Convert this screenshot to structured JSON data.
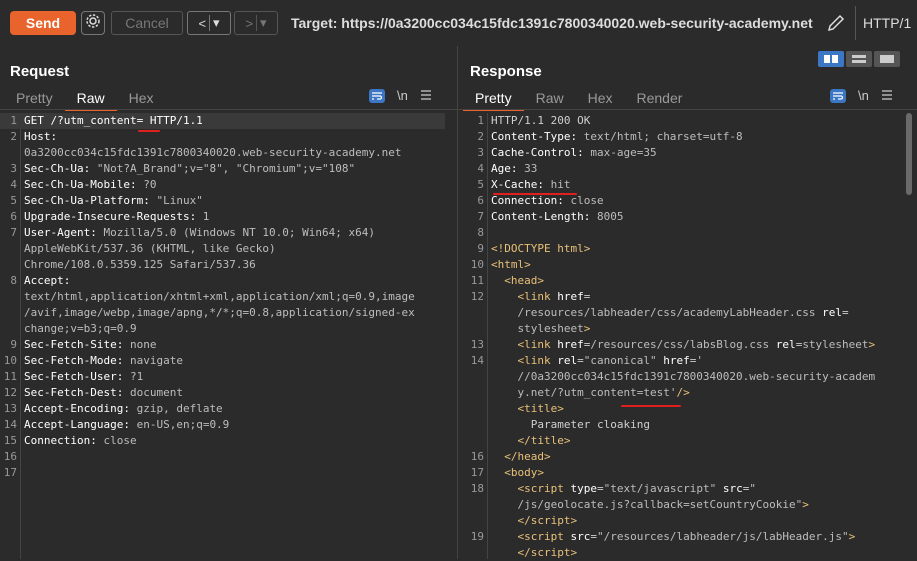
{
  "toolbar": {
    "send_label": "Send",
    "cancel_label": "Cancel",
    "back_label": "<",
    "fwd_label": ">",
    "dropdown_glyph": "▾",
    "target": "Target: https://0a3200cc034c15fdc1391c7800340020.web-security-academy.net",
    "protocol": "HTTP/1"
  },
  "request": {
    "title": "Request",
    "tabs": [
      "Pretty",
      "Raw",
      "Hex"
    ],
    "active_tab": "Raw",
    "newline_toggle": "\\n",
    "lines": [
      {
        "n": "1",
        "k": "GET /?utm_content= HTTP/1.1",
        "v": ""
      },
      {
        "n": "2",
        "k": "Host:",
        "v": ""
      },
      {
        "n": "",
        "k": "",
        "v": "0a3200cc034c15fdc1391c7800340020.web-security-academy.net"
      },
      {
        "n": "3",
        "k": "Sec-Ch-Ua:",
        "v": " \"Not?A_Brand\";v=\"8\", \"Chromium\";v=\"108\""
      },
      {
        "n": "4",
        "k": "Sec-Ch-Ua-Mobile:",
        "v": " ?0"
      },
      {
        "n": "5",
        "k": "Sec-Ch-Ua-Platform:",
        "v": " \"Linux\""
      },
      {
        "n": "6",
        "k": "Upgrade-Insecure-Requests:",
        "v": " 1"
      },
      {
        "n": "7",
        "k": "User-Agent:",
        "v": " Mozilla/5.0 (Windows NT 10.0; Win64; x64)"
      },
      {
        "n": "",
        "k": "",
        "v": "AppleWebKit/537.36 (KHTML, like Gecko)"
      },
      {
        "n": "",
        "k": "",
        "v": "Chrome/108.0.5359.125 Safari/537.36"
      },
      {
        "n": "8",
        "k": "Accept:",
        "v": ""
      },
      {
        "n": "",
        "k": "",
        "v": "text/html,application/xhtml+xml,application/xml;q=0.9,image"
      },
      {
        "n": "",
        "k": "",
        "v": "/avif,image/webp,image/apng,*/*;q=0.8,application/signed-ex"
      },
      {
        "n": "",
        "k": "",
        "v": "change;v=b3;q=0.9"
      },
      {
        "n": "9",
        "k": "Sec-Fetch-Site:",
        "v": " none"
      },
      {
        "n": "10",
        "k": "Sec-Fetch-Mode:",
        "v": " navigate"
      },
      {
        "n": "11",
        "k": "Sec-Fetch-User:",
        "v": " ?1"
      },
      {
        "n": "12",
        "k": "Sec-Fetch-Dest:",
        "v": " document"
      },
      {
        "n": "13",
        "k": "Accept-Encoding:",
        "v": " gzip, deflate"
      },
      {
        "n": "14",
        "k": "Accept-Language:",
        "v": " en-US,en;q=0.9"
      },
      {
        "n": "15",
        "k": "Connection:",
        "v": " close"
      },
      {
        "n": "16",
        "k": "",
        "v": ""
      },
      {
        "n": "17",
        "k": "",
        "v": ""
      }
    ]
  },
  "response": {
    "title": "Response",
    "tabs": [
      "Pretty",
      "Raw",
      "Hex",
      "Render"
    ],
    "active_tab": "Pretty",
    "newline_toggle": "\\n",
    "lines": [
      {
        "n": "1",
        "h": "HTTP/1.1 200 OK"
      },
      {
        "n": "2",
        "h": "<span class=\"k\">Content-Type:</span> <span class=\"v\">text/html; charset=utf-8</span>"
      },
      {
        "n": "3",
        "h": "<span class=\"k\">Cache-Control:</span> <span class=\"v\">max-age=35</span>"
      },
      {
        "n": "4",
        "h": "<span class=\"k\">Age:</span> <span class=\"v\">33</span>"
      },
      {
        "n": "5",
        "h": "<span class=\"k\">X-Cache:</span> <span class=\"v\">hit</span>"
      },
      {
        "n": "6",
        "h": "<span class=\"k\">Connection:</span> <span class=\"v\">close</span>"
      },
      {
        "n": "7",
        "h": "<span class=\"k\">Content-Length:</span> <span class=\"v\">8005</span>"
      },
      {
        "n": "8",
        "h": ""
      },
      {
        "n": "9",
        "h": "<span class=\"tag\">&lt;!DOCTYPE html&gt;</span>"
      },
      {
        "n": "10",
        "h": "<span class=\"tag\">&lt;html&gt;</span>"
      },
      {
        "n": "11",
        "h": "  <span class=\"tag\">&lt;head&gt;</span>"
      },
      {
        "n": "12",
        "h": "    <span class=\"tag\">&lt;link</span> <span class=\"attr\">href</span>="
      },
      {
        "n": "",
        "h": "    <span class=\"str\">/resources/labheader/css/academyLabHeader.css</span> <span class=\"attr\">rel</span>="
      },
      {
        "n": "",
        "h": "    <span class=\"str\">stylesheet</span><span class=\"tag\">&gt;</span>"
      },
      {
        "n": "13",
        "h": "    <span class=\"tag\">&lt;link</span> <span class=\"attr\">href</span>=<span class=\"str\">/resources/css/labsBlog.css</span> <span class=\"attr\">rel</span>=<span class=\"str\">stylesheet</span><span class=\"tag\">&gt;</span>"
      },
      {
        "n": "14",
        "h": "    <span class=\"tag\">&lt;link</span> <span class=\"attr\">rel</span>=<span class=\"str\">\"canonical\"</span> <span class=\"attr\">href</span>=<span class=\"str\">'</span>"
      },
      {
        "n": "",
        "h": "    <span class=\"str\">//0a3200cc034c15fdc1391c7800340020.web-security-academ</span>"
      },
      {
        "n": "",
        "h": "    <span class=\"str\">y.net/?utm_content=test'</span><span class=\"tag\">/&gt;</span>"
      },
      {
        "n": "",
        "h": "    <span class=\"tag\">&lt;title&gt;</span>"
      },
      {
        "n": "",
        "h": "      Parameter cloaking"
      },
      {
        "n": "",
        "h": "    <span class=\"tag\">&lt;/title&gt;</span>"
      },
      {
        "n": "16",
        "h": "  <span class=\"tag\">&lt;/head&gt;</span>"
      },
      {
        "n": "17",
        "h": "  <span class=\"tag\">&lt;body&gt;</span>"
      },
      {
        "n": "18",
        "h": "    <span class=\"tag\">&lt;script</span> <span class=\"attr\">type</span>=<span class=\"str\">\"text/javascript\"</span> <span class=\"attr\">src</span>=<span class=\"str\">\"</span>"
      },
      {
        "n": "",
        "h": "    <span class=\"str\">/js/geolocate.js?callback=setCountryCookie\"</span><span class=\"tag\">&gt;</span>"
      },
      {
        "n": "",
        "h": "    <span class=\"tag\">&lt;/script&gt;</span>"
      },
      {
        "n": "19",
        "h": "    <span class=\"tag\">&lt;script</span> <span class=\"attr\">src</span>=<span class=\"str\">\"/resources/labheader/js/labHeader.js\"</span><span class=\"tag\">&gt;</span>"
      },
      {
        "n": "",
        "h": "    <span class=\"tag\">&lt;/script&gt;</span>"
      }
    ]
  }
}
